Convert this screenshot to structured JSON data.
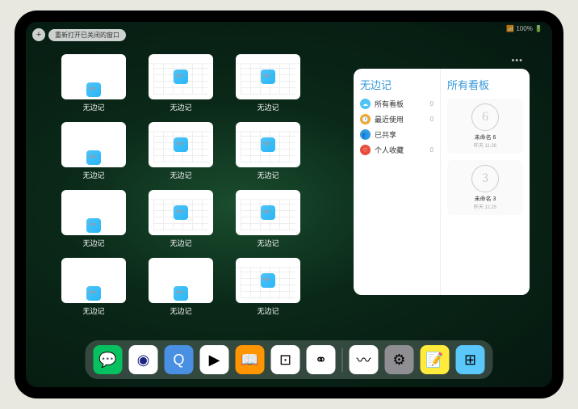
{
  "status": {
    "text": "📶 100% 🔋"
  },
  "topbar": {
    "plus": "+",
    "reopen_label": "重新打开已关闭的窗口"
  },
  "app_label": "无边记",
  "grid_items": [
    {
      "type": "blank"
    },
    {
      "type": "grid"
    },
    {
      "type": "grid"
    },
    {
      "type": "blank"
    },
    {
      "type": "grid"
    },
    {
      "type": "grid"
    },
    {
      "type": "blank"
    },
    {
      "type": "grid"
    },
    {
      "type": "grid"
    },
    {
      "type": "blank"
    },
    {
      "type": "blank"
    },
    {
      "type": "grid"
    }
  ],
  "panel": {
    "left_title": "无边记",
    "rows": [
      {
        "icon": "☁",
        "color": "#4fc3f7",
        "label": "所有看板",
        "count": "0"
      },
      {
        "icon": "🕐",
        "color": "#f5a623",
        "label": "最近使用",
        "count": "0"
      },
      {
        "icon": "👥",
        "color": "#3498db",
        "label": "已共享",
        "count": ""
      },
      {
        "icon": "♡",
        "color": "#e74c3c",
        "label": "个人收藏",
        "count": "0"
      }
    ],
    "right_title": "所有看板",
    "cards": [
      {
        "glyph": "6",
        "name": "未命名 6",
        "time": "昨天 11:26"
      },
      {
        "glyph": "3",
        "name": "未命名 3",
        "time": "昨天 11:25"
      }
    ]
  },
  "dock": [
    {
      "name": "wechat",
      "bg": "#07c160",
      "glyph": "💬"
    },
    {
      "name": "quark",
      "bg": "#fff",
      "glyph": "◉"
    },
    {
      "name": "browser",
      "bg": "#4a90e2",
      "glyph": "Q"
    },
    {
      "name": "play",
      "bg": "#fff",
      "glyph": "▶"
    },
    {
      "name": "books",
      "bg": "#ff9500",
      "glyph": "📖"
    },
    {
      "name": "dice",
      "bg": "#fff",
      "glyph": "⊡"
    },
    {
      "name": "connect",
      "bg": "#fff",
      "glyph": "⚭"
    },
    {
      "name": "freeform",
      "bg": "#fff",
      "glyph": "〰"
    },
    {
      "name": "settings",
      "bg": "#8e8e93",
      "glyph": "⚙"
    },
    {
      "name": "notes",
      "bg": "#ffeb3b",
      "glyph": "📝"
    },
    {
      "name": "apps",
      "bg": "#5ac8fa",
      "glyph": "⊞"
    }
  ]
}
